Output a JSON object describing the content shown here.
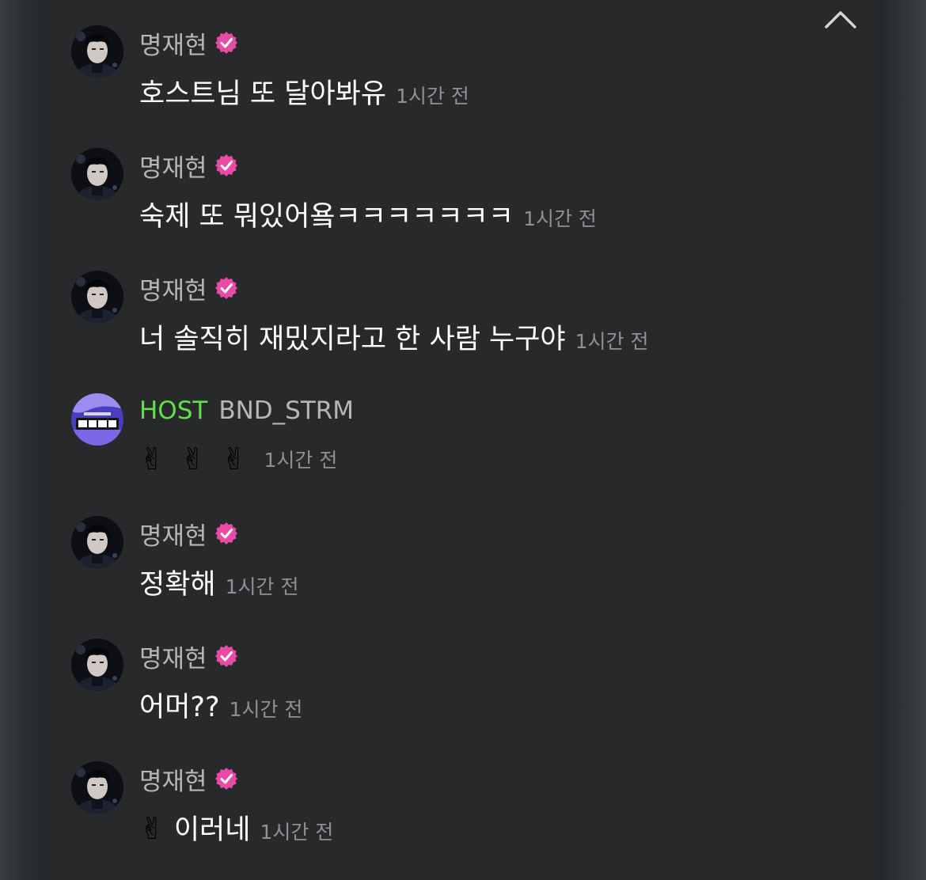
{
  "icons": {
    "collapse": "chevron-up-icon",
    "verified": "verified-badge-icon",
    "peace": "victory-hand-emoji"
  },
  "colors": {
    "panel": "#28292b",
    "username": "#b4b6b8",
    "host": "#5fe04a",
    "verified": "#e94aa6",
    "text": "#ffffff",
    "time": "#8e9093"
  },
  "messages": [
    {
      "user": "명재현",
      "text": "호스트님 또 달아봐유",
      "time": "1시간 전"
    },
    {
      "user": "명재현",
      "text": "숙제 또 뭐있어욬ㅋㅋㅋㅋㅋㅋㅋ",
      "time": "1시간 전"
    },
    {
      "user": "명재현",
      "text": "너 솔직히 재밌지라고 한 사람 누구야",
      "time": "1시간 전"
    },
    {
      "host_label": "HOST",
      "user": "BND_STRM",
      "emoji": [
        "✌",
        "✌",
        "✌"
      ],
      "time": "1시간 전"
    },
    {
      "user": "명재현",
      "text": "정확해",
      "time": "1시간 전"
    },
    {
      "user": "명재현",
      "text": "어머??",
      "time": "1시간 전"
    },
    {
      "user": "명재현",
      "emoji": [
        "✌"
      ],
      "text": "이러네",
      "time": "1시간 전"
    }
  ]
}
